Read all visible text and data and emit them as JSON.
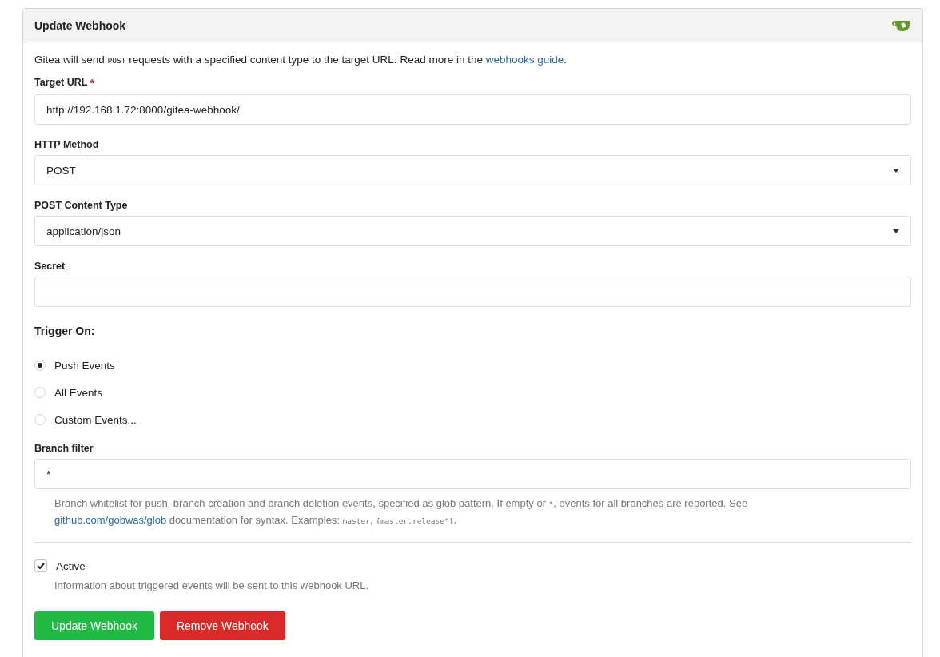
{
  "panel": {
    "title": "Update Webhook"
  },
  "intro": [
    {
      "kind": "text",
      "text": "Gitea will send "
    },
    {
      "kind": "code",
      "text": "POST"
    },
    {
      "kind": "text",
      "text": " requests with a specified content type to the target URL. Read more in the "
    },
    {
      "kind": "link",
      "text": "webhooks guide"
    },
    {
      "kind": "text",
      "text": "."
    }
  ],
  "fields": [
    {
      "kind": "input",
      "label": "Target URL",
      "required": true,
      "value": "http://192.168.1.72:8000/gitea-webhook/"
    },
    {
      "kind": "select",
      "label": "HTTP Method",
      "required": false,
      "value": "POST"
    },
    {
      "kind": "select",
      "label": "POST Content Type",
      "required": false,
      "value": "application/json"
    },
    {
      "kind": "input",
      "label": "Secret",
      "required": false
    }
  ],
  "trigger": {
    "title": "Trigger On:",
    "options": [
      {
        "label": "Push Events",
        "selected": true
      },
      {
        "label": "All Events",
        "selected": false
      },
      {
        "label": "Custom Events...",
        "selected": false
      }
    ]
  },
  "branch_filter": {
    "label": "Branch filter",
    "value": "*",
    "help": [
      {
        "kind": "text",
        "text": "Branch whitelist for push, branch creation and branch deletion events, specified as glob pattern. If empty or "
      },
      {
        "kind": "code",
        "text": "*"
      },
      {
        "kind": "text",
        "text": ", events for all branches are reported. See "
      },
      {
        "kind": "link",
        "text": "github.com/gobwas/glob"
      },
      {
        "kind": "text",
        "text": " documentation for syntax. Examples: "
      },
      {
        "kind": "code",
        "text": "master"
      },
      {
        "kind": "text",
        "text": ", "
      },
      {
        "kind": "code",
        "text": "{master,release*}"
      },
      {
        "kind": "text",
        "text": "."
      }
    ]
  },
  "active": {
    "label": "Active",
    "checked": true,
    "help": "Information about triggered events will be sent to this webhook URL."
  },
  "buttons": [
    {
      "kind": "primary",
      "label": "Update Webhook"
    },
    {
      "kind": "danger",
      "label": "Remove Webhook"
    }
  ]
}
